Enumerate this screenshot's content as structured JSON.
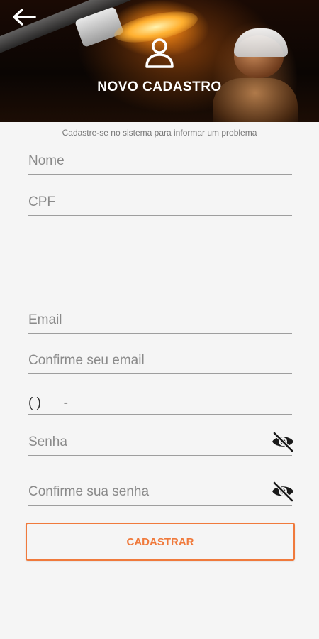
{
  "header": {
    "title": "NOVO CADASTRO",
    "back_icon": "arrow-left-icon",
    "user_icon": "user-icon"
  },
  "subtitle": "Cadastre-se no sistema para informar um problema",
  "form": {
    "nome": {
      "placeholder": "Nome",
      "value": ""
    },
    "cpf": {
      "placeholder": "CPF",
      "value": ""
    },
    "email": {
      "placeholder": "Email",
      "value": ""
    },
    "confirm_email": {
      "placeholder": "Confirme seu email",
      "value": ""
    },
    "phone": {
      "mask": "( )      -"
    },
    "senha": {
      "placeholder": "Senha",
      "value": "",
      "toggle_icon": "eye-off-icon"
    },
    "confirm_senha": {
      "placeholder": "Confirme sua senha",
      "value": "",
      "toggle_icon": "eye-off-icon"
    }
  },
  "submit_label": "CADASTRAR",
  "colors": {
    "accent": "#f07a3c",
    "background": "#f5f5f5",
    "underline": "#9e9e9e"
  }
}
